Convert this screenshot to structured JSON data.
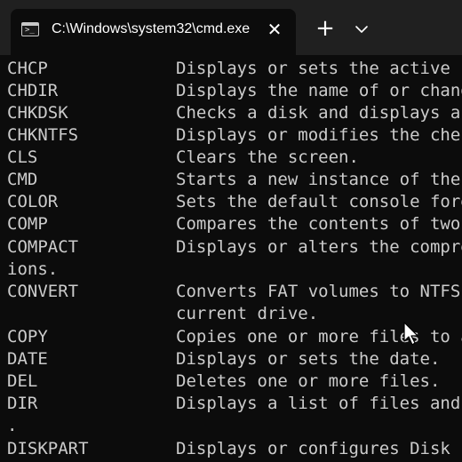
{
  "window": {
    "tab_title": "C:\\Windows\\system32\\cmd.exe",
    "tab_icon_glyph": ">_",
    "close_glyph": "✕",
    "new_tab_glyph": "+"
  },
  "terminal": {
    "text_color": "#cccccc",
    "background_color": "#0c0c0c",
    "lines": [
      {
        "cmd": "CHCP",
        "desc": "Displays or sets the active code page number."
      },
      {
        "cmd": "CHDIR",
        "desc": "Displays the name of or changes the current directory."
      },
      {
        "cmd": "CHKDSK",
        "desc": "Checks a disk and displays a status report."
      },
      {
        "cmd": "CHKNTFS",
        "desc": "Displays or modifies the checking of disk at boot time."
      },
      {
        "cmd": "CLS",
        "desc": "Clears the screen."
      },
      {
        "cmd": "CMD",
        "desc": "Starts a new instance of the Windows command interpreter."
      },
      {
        "cmd": "COLOR",
        "desc": "Sets the default console foreground and background colors."
      },
      {
        "cmd": "COMP",
        "desc": "Compares the contents of two files or sets of files."
      },
      {
        "cmd": "COMPACT",
        "desc": "Displays or alters the compression of files on NTFS partit"
      },
      {
        "cmd": "ions.",
        "desc": ""
      },
      {
        "cmd": "CONVERT",
        "desc": "Converts FAT volumes to NTFS.  You cannot convert the"
      },
      {
        "cmd": "",
        "desc": "current drive."
      },
      {
        "cmd": "COPY",
        "desc": "Copies one or more files to another location."
      },
      {
        "cmd": "DATE",
        "desc": "Displays or sets the date."
      },
      {
        "cmd": "DEL",
        "desc": "Deletes one or more files."
      },
      {
        "cmd": "DIR",
        "desc": "Displays a list of files and subdirectories in a directory"
      },
      {
        "cmd": ".",
        "desc": ""
      },
      {
        "cmd": "DISKPART",
        "desc": "Displays or configures Disk Partition properties."
      }
    ]
  }
}
